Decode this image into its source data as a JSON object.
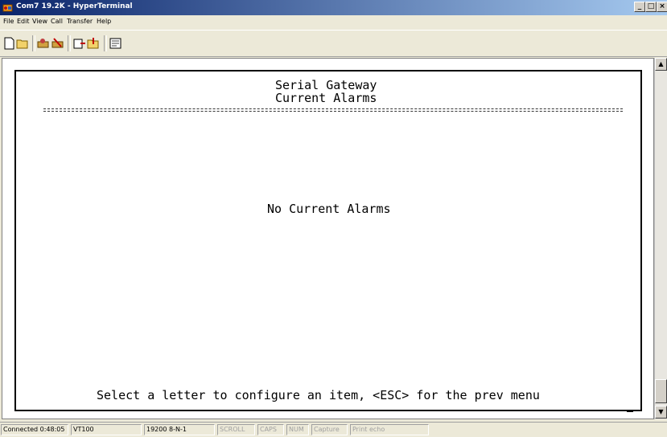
{
  "window": {
    "title": "Com7 19.2K - HyperTerminal",
    "minimize": "_",
    "maximize": "□",
    "close": "×"
  },
  "menu": {
    "items": [
      "File",
      "Edit",
      "View",
      "Call",
      "Transfer",
      "Help"
    ]
  },
  "toolbar": {
    "buttons": [
      "new-icon",
      "open-icon",
      "connect-icon",
      "disconnect-icon",
      "send-icon",
      "receive-icon",
      "properties-icon"
    ]
  },
  "terminal": {
    "heading_line1": "Serial Gateway",
    "heading_line2": "Current Alarms",
    "message": "No Current Alarms",
    "prompt": "Select a letter to configure an item, <ESC> for the prev menu"
  },
  "status": {
    "connected": "Connected 0:48:05",
    "emulation": "VT100",
    "settings": "19200 8-N-1",
    "scroll": "SCROLL",
    "caps": "CAPS",
    "num": "NUM",
    "capture": "Capture",
    "print_echo": "Print echo"
  }
}
